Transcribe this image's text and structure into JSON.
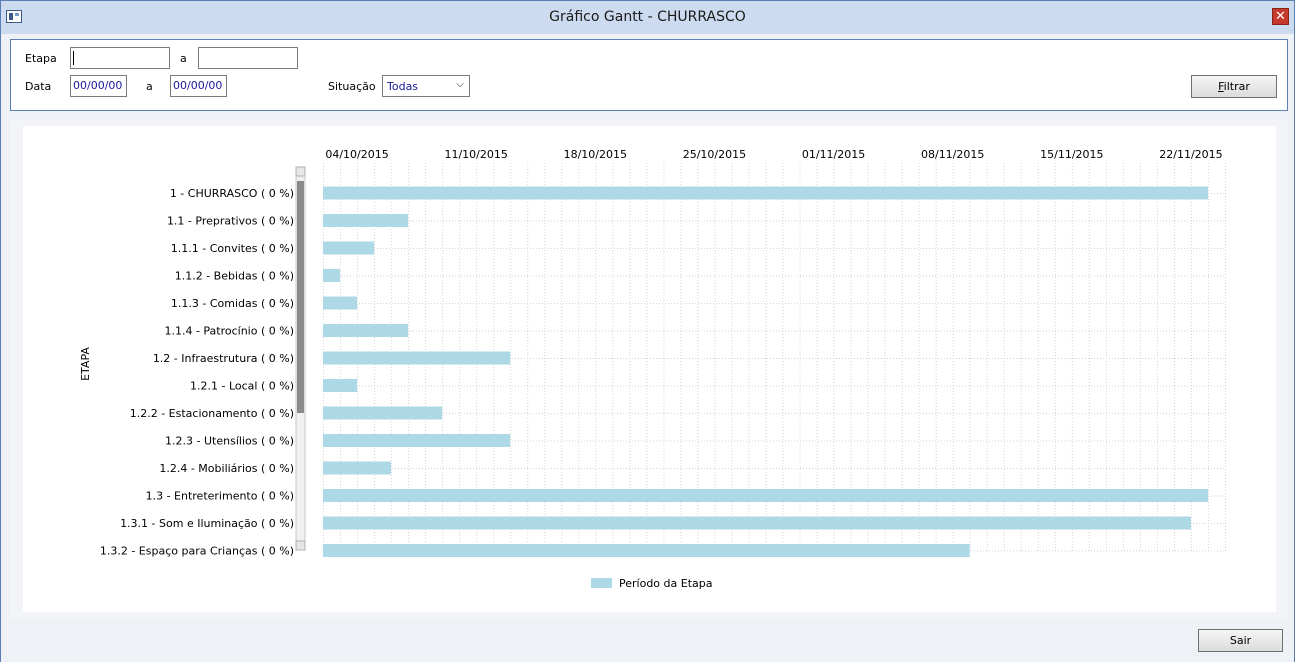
{
  "window": {
    "title": "Gráfico Gantt  - CHURRASCO"
  },
  "filters": {
    "etapa_label": "Etapa",
    "etapa_from": "",
    "to_label_1": "a",
    "etapa_to": "",
    "data_label": "Data",
    "data_from": "00/00/00",
    "to_label_2": "a",
    "data_to": "00/00/00",
    "situacao_label": "Situação",
    "situacao_value": "Todas",
    "filter_button_accel": "F",
    "filter_button_rest": "iltrar"
  },
  "footer": {
    "exit_button": "Sair"
  },
  "chart_data": {
    "type": "bar",
    "subtype": "gantt",
    "ylabel": "ETAPA",
    "x_ticks": [
      "04/10/2015",
      "11/10/2015",
      "18/10/2015",
      "25/10/2015",
      "01/11/2015",
      "08/11/2015",
      "15/11/2015",
      "22/11/2015"
    ],
    "x_range": [
      "2015-10-02",
      "2015-11-24"
    ],
    "legend": {
      "label": "Período da Etapa",
      "position": "bottom"
    },
    "grid": true,
    "bar_color": "#add8e6",
    "tasks": [
      {
        "label": "1 - CHURRASCO  ( 0 %)",
        "start": "2015-10-02",
        "end": "2015-11-23"
      },
      {
        "label": "1.1 - Preprativos  ( 0 %)",
        "start": "2015-10-02",
        "end": "2015-10-07"
      },
      {
        "label": "1.1.1 - Convites  ( 0 %)",
        "start": "2015-10-02",
        "end": "2015-10-05"
      },
      {
        "label": "1.1.2 - Bebidas  ( 0 %)",
        "start": "2015-10-02",
        "end": "2015-10-03"
      },
      {
        "label": "1.1.3 - Comidas  ( 0 %)",
        "start": "2015-10-02",
        "end": "2015-10-04"
      },
      {
        "label": "1.1.4 - Patrocínio  ( 0 %)",
        "start": "2015-10-02",
        "end": "2015-10-07"
      },
      {
        "label": "1.2 - Infraestrutura  ( 0 %)",
        "start": "2015-10-02",
        "end": "2015-10-13"
      },
      {
        "label": "1.2.1 - Local  ( 0 %)",
        "start": "2015-10-02",
        "end": "2015-10-04"
      },
      {
        "label": "1.2.2 - Estacionamento  ( 0 %)",
        "start": "2015-10-02",
        "end": "2015-10-09"
      },
      {
        "label": "1.2.3 - Utensílios  ( 0 %)",
        "start": "2015-10-02",
        "end": "2015-10-13"
      },
      {
        "label": "1.2.4 - Mobiliários  ( 0 %)",
        "start": "2015-10-02",
        "end": "2015-10-06"
      },
      {
        "label": "1.3 - Entreterimento  ( 0 %)",
        "start": "2015-10-02",
        "end": "2015-11-23"
      },
      {
        "label": "1.3.1 - Som e Iluminação  ( 0 %)",
        "start": "2015-10-02",
        "end": "2015-11-22"
      },
      {
        "label": "1.3.2 - Espaço para Crianças  ( 0 %)",
        "start": "2015-10-02",
        "end": "2015-11-09"
      }
    ]
  }
}
